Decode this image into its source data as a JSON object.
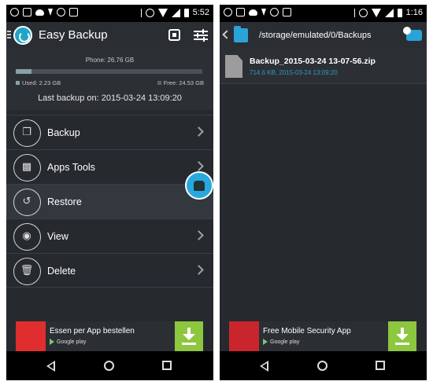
{
  "left": {
    "status": {
      "time": "5:52"
    },
    "app": {
      "title": "Easy Backup"
    },
    "storage": {
      "phone_label": "Phone: 26.76 GB",
      "used_label": "Used: 2.23 GB",
      "free_label": "Free: 24.53 GB",
      "used_fraction": 0.083,
      "last_backup": "Last backup on: 2015-03-24 13:09:20"
    },
    "menu": [
      {
        "label": "Backup",
        "icon": "phone-copy-icon"
      },
      {
        "label": "Apps Tools",
        "icon": "android-icon"
      },
      {
        "label": "Restore",
        "icon": "restore-icon"
      },
      {
        "label": "View",
        "icon": "eye-icon"
      },
      {
        "label": "Delete",
        "icon": "trash-icon"
      }
    ],
    "ad": {
      "title": "Essen per App bestellen",
      "store": "Google play"
    }
  },
  "right": {
    "status": {
      "time": "1:16"
    },
    "path": "/storage/emulated/0/Backups",
    "files": [
      {
        "name": "Backup_2015-03-24 13-07-56.zip",
        "meta": "714.6 KB, 2015-03-24 13:09:20"
      }
    ],
    "ad": {
      "title": "Free Mobile Security App",
      "store": "Google play"
    }
  },
  "colors": {
    "accent": "#29a8e0",
    "download": "#8dc63f",
    "background": "#262a2f"
  }
}
